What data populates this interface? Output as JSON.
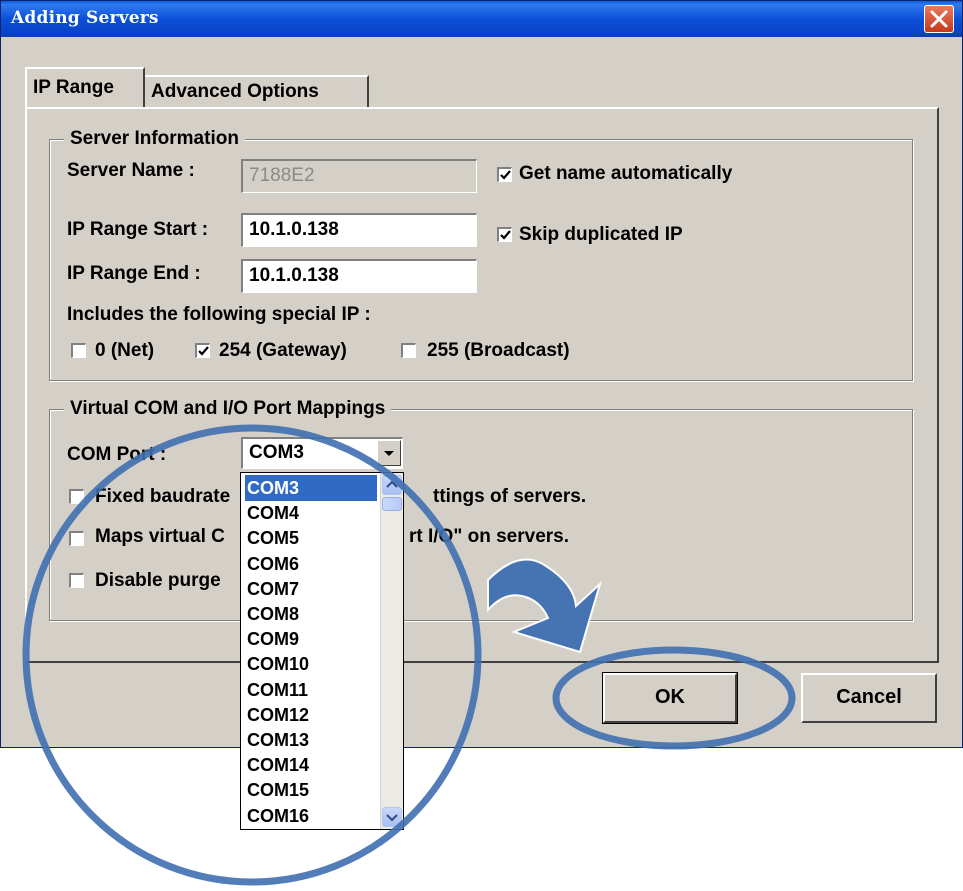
{
  "window": {
    "title": "Adding Servers"
  },
  "tabs": {
    "active": "IP Range",
    "inactive": "Advanced Options"
  },
  "server_info": {
    "legend": "Server Information",
    "server_name_label": "Server Name :",
    "server_name_value": "7188E2",
    "get_name_auto": {
      "label": "Get name automatically",
      "checked": true
    },
    "ip_start_label": "IP Range Start :",
    "ip_start_value": "10.1.0.138",
    "skip_dup": {
      "label": "Skip duplicated IP",
      "checked": true
    },
    "ip_end_label": "IP Range End :",
    "ip_end_value": "10.1.0.138",
    "special_ip_label": "Includes the following special IP :",
    "special_ips": [
      {
        "label": "0 (Net)",
        "checked": false
      },
      {
        "label": "254 (Gateway)",
        "checked": true
      },
      {
        "label": "255 (Broadcast)",
        "checked": false
      }
    ]
  },
  "mappings": {
    "legend": "Virtual COM and I/O Port Mappings",
    "com_port_label": "COM Port :",
    "com_port_value": "COM3",
    "options": [
      {
        "label": "Fixed baudrate",
        "suffix": "ttings of servers.",
        "checked": false
      },
      {
        "label": "Maps virtual C",
        "suffix": "rt I/O\" on servers.",
        "checked": false
      },
      {
        "label": "Disable purge",
        "checked": false
      }
    ],
    "dropdown_items": [
      "COM3",
      "COM4",
      "COM5",
      "COM6",
      "COM7",
      "COM8",
      "COM9",
      "COM10",
      "COM11",
      "COM12",
      "COM13",
      "COM14",
      "COM15",
      "COM16"
    ],
    "dropdown_selected_index": 0
  },
  "buttons": {
    "ok": "OK",
    "cancel": "Cancel"
  },
  "colors": {
    "annotation": "#3f6fb0",
    "titlebar": "#0b4fd8",
    "selection": "#316ac5"
  }
}
